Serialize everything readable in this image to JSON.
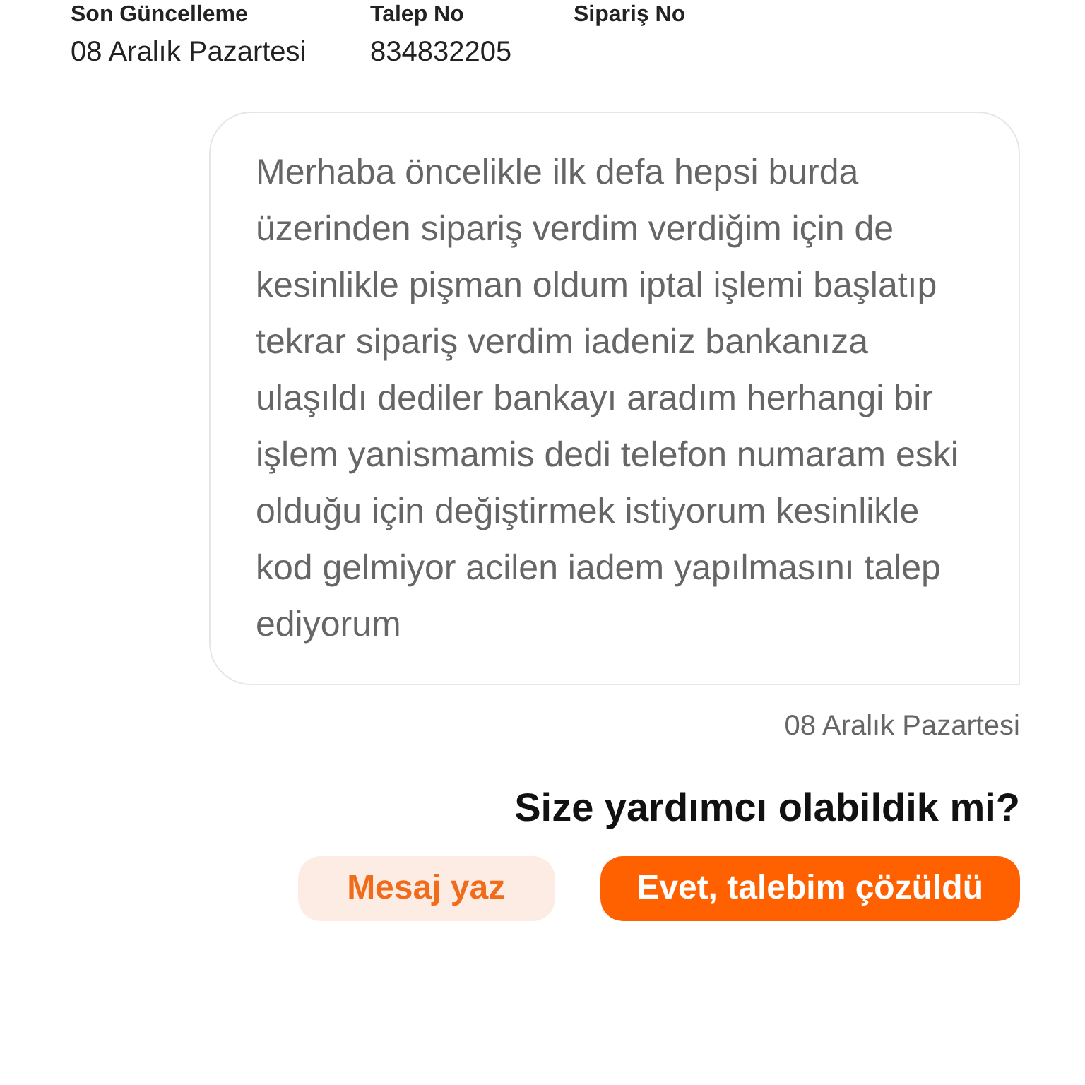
{
  "info_columns": [
    {
      "label": "Son Güncelleme",
      "value": "08 Aralık Pazartesi"
    },
    {
      "label": "Talep No",
      "value": "834832205"
    },
    {
      "label": "Sipariş No"
    }
  ],
  "message": {
    "text": "Merhaba öncelikle ilk defa hepsi burda üzerinden sipariş verdim verdiğim için de kesinlikle pişman oldum iptal işlemi başlatıp tekrar sipariş verdim iadeniz bankanıza ulaşıldı dediler bankayı aradım herhangi bir işlem yanismamis dedi telefon numaram eski olduğu için değiştirmek istiyorum kesinlikle kod gelmiyor acilen iadem yapılmasını talep ediyorum",
    "date": "08 Aralık Pazartesi"
  },
  "feedback": {
    "question": "Size yardımcı olabildik mi?",
    "buttons": [
      {
        "label": "Mesaj yaz",
        "kind": "secondary"
      },
      {
        "label": "Evet, talebim çözüldü",
        "kind": "primary"
      }
    ]
  }
}
